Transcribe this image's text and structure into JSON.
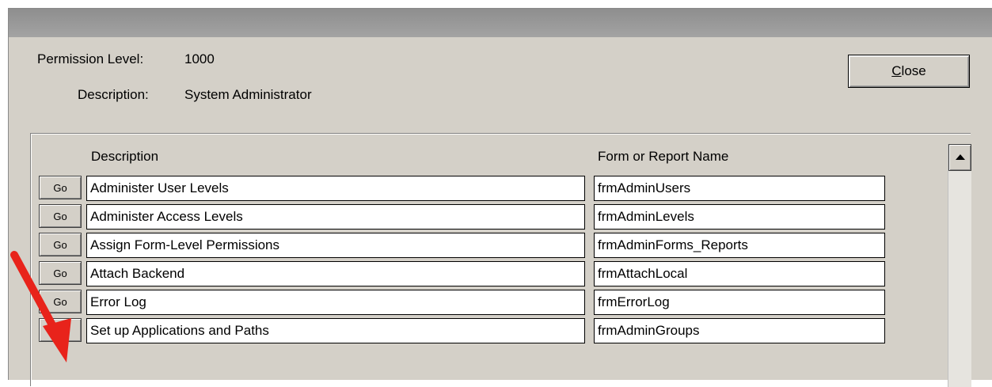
{
  "header": {
    "permission_label": "Permission Level:",
    "permission_value": "1000",
    "description_label": "Description:",
    "description_value": "System Administrator",
    "close_prefix": "",
    "close_mnemonic": "C",
    "close_rest": "lose"
  },
  "table": {
    "columns": [
      "Description",
      "Form or Report Name"
    ],
    "go_label": "Go",
    "rows": [
      {
        "description": "Administer User Levels",
        "form": "frmAdminUsers"
      },
      {
        "description": "Administer Access Levels",
        "form": "frmAdminLevels"
      },
      {
        "description": "Assign Form-Level Permissions",
        "form": "frmAdminForms_Reports"
      },
      {
        "description": "Attach Backend",
        "form": "frmAttachLocal"
      },
      {
        "description": "Error Log",
        "form": "frmErrorLog"
      },
      {
        "description": "Set up Applications and Paths",
        "form": "frmAdminGroups"
      }
    ]
  },
  "colors": {
    "annotation_arrow": "#e8231b",
    "window_bg": "#d4d0c8"
  },
  "icons": {
    "scroll_up": "triangle-up-icon",
    "annotation": "red-arrow-icon"
  }
}
